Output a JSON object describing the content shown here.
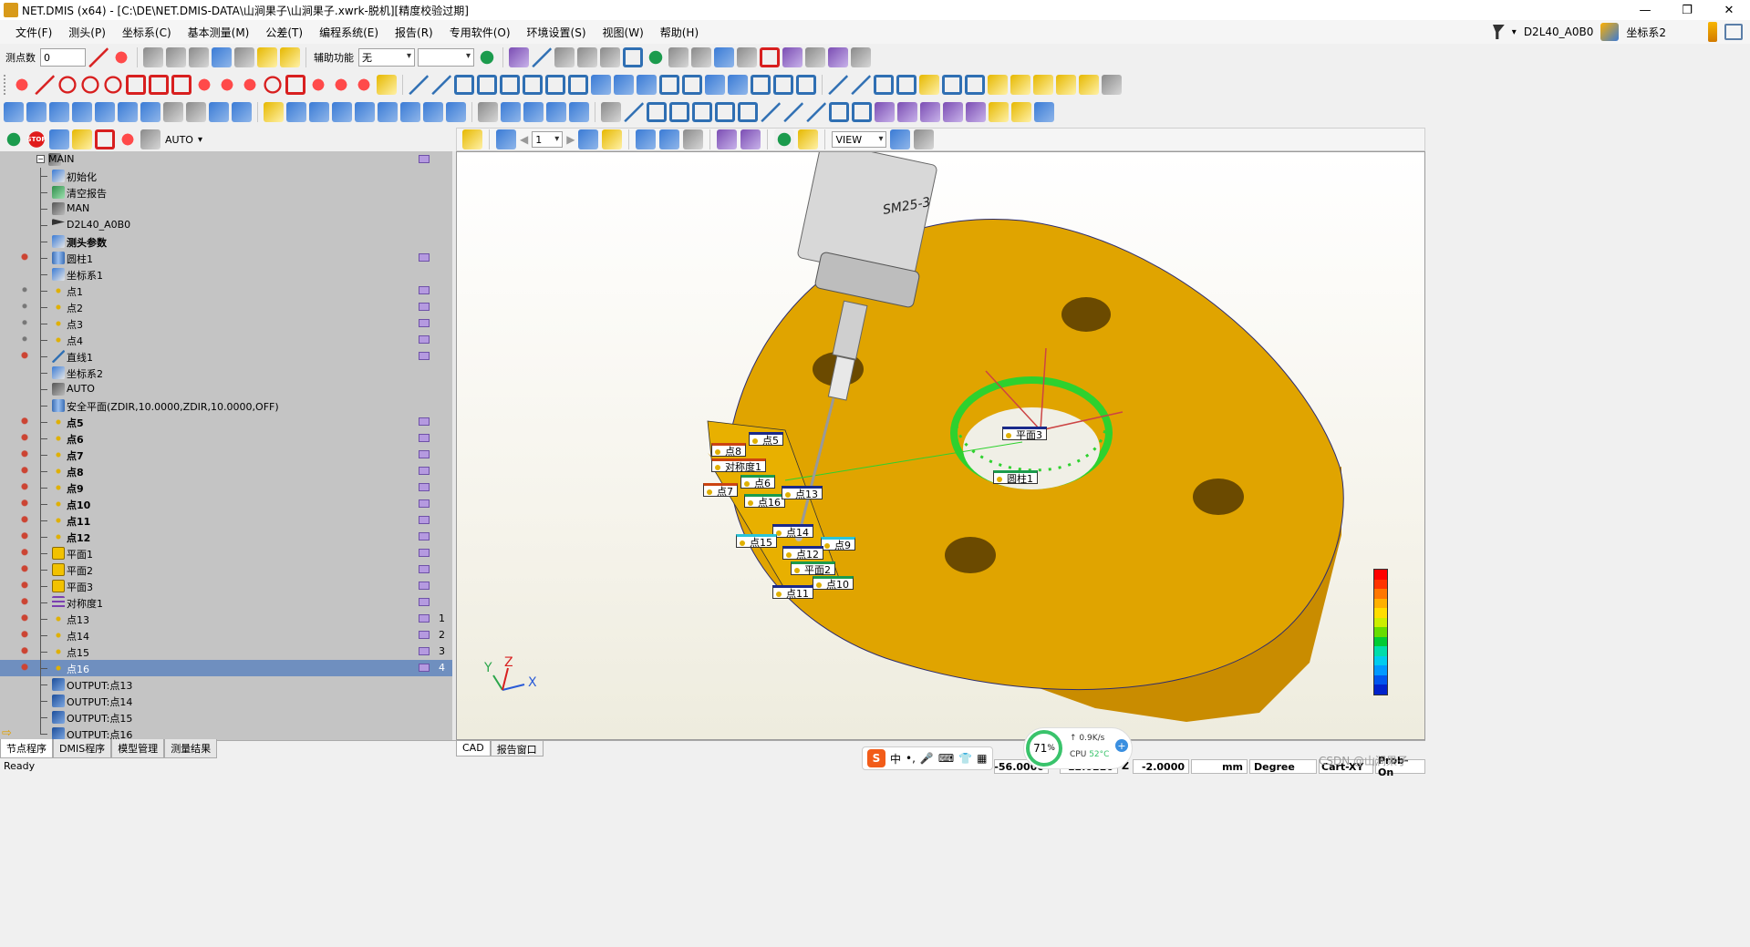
{
  "window": {
    "title": "NET.DMIS (x64) - [C:\\DE\\NET.DMIS-DATA\\山涧果子\\山涧果子.xwrk-脱机][精度校验过期]",
    "min": "—",
    "max": "❐",
    "close": "✕"
  },
  "menu": {
    "items": [
      "文件(F)",
      "测头(P)",
      "坐标系(C)",
      "基本测量(M)",
      "公差(T)",
      "编程系统(E)",
      "报告(R)",
      "专用软件(O)",
      "环境设置(S)",
      "视图(W)",
      "帮助(H)"
    ],
    "probe": "D2L40_A0B0",
    "coord_system": "坐标系2"
  },
  "toolbar1": {
    "point_count_label": "测点数",
    "point_count_value": "0",
    "aux_label": "辅助功能",
    "aux_value": "无",
    "aux_second_value": ""
  },
  "toolbar5": {
    "mode_value": "AUTO"
  },
  "tree": {
    "rows": [
      {
        "text": "MAIN",
        "icon": "ico-mode",
        "tag": true,
        "root": true
      },
      {
        "text": "初始化",
        "icon": "ico-sys"
      },
      {
        "text": "清空报告",
        "icon": "ico-grn"
      },
      {
        "text": "MAN",
        "icon": "ico-mode"
      },
      {
        "text": "D2L40_A0B0",
        "icon": "ico-flag"
      },
      {
        "text": "测头参数",
        "icon": "ico-sys",
        "bold": true
      },
      {
        "text": "圆柱1",
        "icon": "ico-cyl",
        "tag": true,
        "marker": "bulb"
      },
      {
        "text": "坐标系1",
        "icon": "ico-sys"
      },
      {
        "text": "点1",
        "icon": "ico-pt",
        "tag": true,
        "marker": "dot"
      },
      {
        "text": "点2",
        "icon": "ico-pt",
        "tag": true,
        "marker": "dot"
      },
      {
        "text": "点3",
        "icon": "ico-pt",
        "tag": true,
        "marker": "dot"
      },
      {
        "text": "点4",
        "icon": "ico-pt",
        "tag": true,
        "marker": "dot"
      },
      {
        "text": "直线1",
        "icon": "ico-line",
        "tag": true,
        "marker": "bulb"
      },
      {
        "text": "坐标系2",
        "icon": "ico-sys"
      },
      {
        "text": "AUTO",
        "icon": "ico-mode"
      },
      {
        "text": "安全平面(ZDIR,10.0000,ZDIR,10.0000,OFF)",
        "icon": "ico-cyl"
      },
      {
        "text": "点5",
        "icon": "ico-pt",
        "tag": true,
        "marker": "bulb",
        "bold": true
      },
      {
        "text": "点6",
        "icon": "ico-pt",
        "tag": true,
        "marker": "bulb",
        "bold": true
      },
      {
        "text": "点7",
        "icon": "ico-pt",
        "tag": true,
        "marker": "bulb",
        "bold": true
      },
      {
        "text": "点8",
        "icon": "ico-pt",
        "tag": true,
        "marker": "bulb",
        "bold": true
      },
      {
        "text": "点9",
        "icon": "ico-pt",
        "tag": true,
        "marker": "bulb",
        "bold": true
      },
      {
        "text": "点10",
        "icon": "ico-pt",
        "tag": true,
        "marker": "bulb",
        "bold": true
      },
      {
        "text": "点11",
        "icon": "ico-pt",
        "tag": true,
        "marker": "bulb",
        "bold": true
      },
      {
        "text": "点12",
        "icon": "ico-pt",
        "tag": true,
        "marker": "bulb",
        "bold": true
      },
      {
        "text": "平面1",
        "icon": "ico-pln",
        "tag": true,
        "marker": "bulb"
      },
      {
        "text": "平面2",
        "icon": "ico-pln",
        "tag": true,
        "marker": "bulb"
      },
      {
        "text": "平面3",
        "icon": "ico-pln",
        "tag": true,
        "marker": "bulb"
      },
      {
        "text": "对称度1",
        "icon": "ico-sym",
        "tag": true,
        "marker": "bulb"
      },
      {
        "text": "点13",
        "icon": "ico-pt",
        "tag": true,
        "marker": "bulb",
        "num": "1"
      },
      {
        "text": "点14",
        "icon": "ico-pt",
        "tag": true,
        "marker": "bulb",
        "num": "2"
      },
      {
        "text": "点15",
        "icon": "ico-pt",
        "tag": true,
        "marker": "bulb",
        "num": "3"
      },
      {
        "text": "点16",
        "icon": "ico-pt",
        "tag": true,
        "marker": "bulb",
        "num": "4",
        "selected": true
      },
      {
        "text": "OUTPUT:点13",
        "icon": "ico-out"
      },
      {
        "text": "OUTPUT:点14",
        "icon": "ico-out"
      },
      {
        "text": "OUTPUT:点15",
        "icon": "ico-out"
      },
      {
        "text": "OUTPUT:点16",
        "icon": "ico-out",
        "arrow": true
      }
    ]
  },
  "left_tabs": [
    "节点程序",
    "DMIS程序",
    "模型管理",
    "测量结果"
  ],
  "view_toolbar": {
    "page_value": "1",
    "view_value": "VIEW"
  },
  "viewport": {
    "probe_label": "SM25-3",
    "axes": {
      "x": "X",
      "y": "Y",
      "z": "Z"
    },
    "labels": [
      "点5",
      "点8",
      "对称度1",
      "点6",
      "点7",
      "点16",
      "点13",
      "点14",
      "点15",
      "点9",
      "点12",
      "平面2",
      "点10",
      "点11",
      "平面3",
      "圆柱1"
    ],
    "colors": {
      "part": "#e0a400",
      "part_side": "#c98c00",
      "cylinder": "#2ed12e"
    }
  },
  "viewport_tabs": [
    "CAD",
    "报告窗口"
  ],
  "status": {
    "ready": "Ready",
    "x_value": "-56.0000",
    "y_value": "-12.0220",
    "z_label": "Z",
    "z_value": "-2.0000",
    "unit": "mm",
    "angle": "Degree",
    "mode": "Cart-XY",
    "probe_state": "Prob-On"
  },
  "ime": {
    "brand": "S",
    "lang": "中"
  },
  "cpu": {
    "usage": "71",
    "usage_unit": "%",
    "speed": "0.9K/s",
    "temp_label": "CPU",
    "temp_value": "52°C"
  },
  "watermark": "CSDN @山涧果子"
}
